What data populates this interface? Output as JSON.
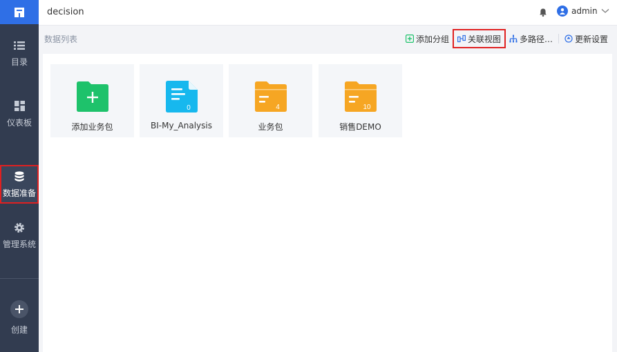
{
  "app": {
    "title": "decision"
  },
  "user": {
    "name": "admin"
  },
  "sidebar": {
    "items": [
      {
        "label": "目录",
        "icon": "list-icon"
      },
      {
        "label": "仪表板",
        "icon": "dashboard-icon"
      },
      {
        "label": "数据准备",
        "icon": "database-icon",
        "active": true
      },
      {
        "label": "管理系统",
        "icon": "gear-icon"
      }
    ],
    "create_label": "创建"
  },
  "content": {
    "section_title": "数据列表",
    "toolbar": {
      "add_group": "添加分组",
      "relation_view": "关联视图",
      "multi_path": "多路径…",
      "update_settings": "更新设置"
    },
    "cards": [
      {
        "label": "添加业务包",
        "icon": "add-folder-icon",
        "color": "#1ec26b"
      },
      {
        "label": "BI-My_Analysis",
        "icon": "document-icon",
        "count": "0",
        "color": "#17b8ee"
      },
      {
        "label": "业务包",
        "icon": "folder-icon",
        "count": "4",
        "color": "#f6a623"
      },
      {
        "label": "销售DEMO",
        "icon": "folder-icon",
        "count": "10",
        "color": "#f6a623"
      }
    ]
  }
}
